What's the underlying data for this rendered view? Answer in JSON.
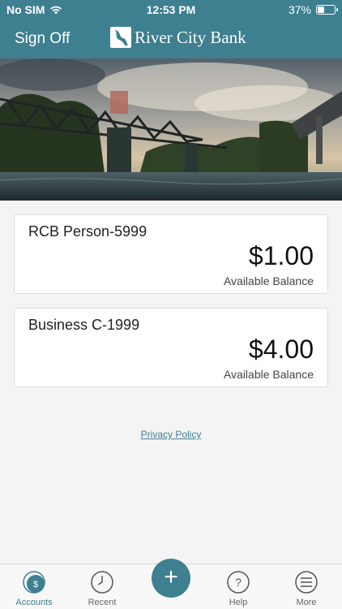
{
  "status_bar": {
    "carrier": "No SIM",
    "time": "12:53 PM",
    "battery": "37%"
  },
  "header": {
    "sign_off": "Sign Off",
    "brand_name": "River City Bank",
    "color": "#3e7f90"
  },
  "accounts": [
    {
      "name": "RCB Person-5999",
      "balance": "$1.00",
      "balance_label": "Available Balance"
    },
    {
      "name": "Business C-1999",
      "balance": "$4.00",
      "balance_label": "Available Balance"
    }
  ],
  "privacy_link": "Privacy Policy",
  "tabs": [
    {
      "label": "Accounts",
      "icon": "dollar-icon",
      "active": true
    },
    {
      "label": "Recent",
      "icon": "clock-icon"
    },
    {
      "label": "",
      "icon": "plus-icon"
    },
    {
      "label": "Help",
      "icon": "question-icon"
    },
    {
      "label": "More",
      "icon": "menu-icon"
    }
  ],
  "fab_symbol": "+"
}
